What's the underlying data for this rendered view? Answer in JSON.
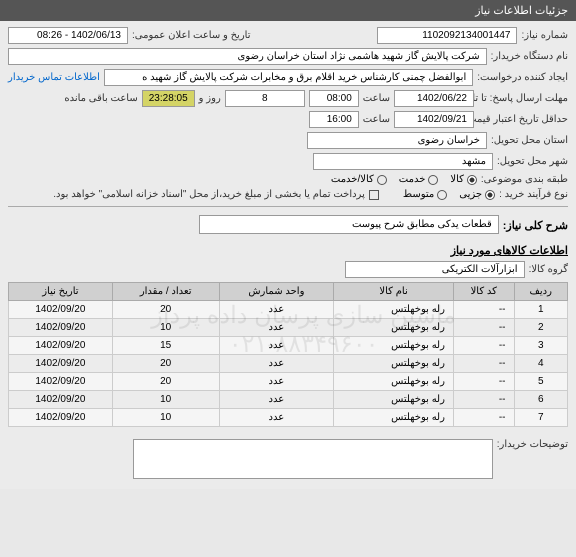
{
  "header": {
    "title": "جزئیات اطلاعات نیاز"
  },
  "fields": {
    "need_number_label": "شماره نیاز:",
    "need_number": "1102092134001447",
    "announce_label": "تاریخ و ساعت اعلان عمومی:",
    "announce_value": "1402/06/13 - 08:26",
    "buyer_label": "نام دستگاه خریدار:",
    "buyer_value": "شرکت پالایش گاز شهید هاشمی نژاد   استان خراسان رضوی",
    "creator_label": "ایجاد کننده درخواست:",
    "creator_value": "ابوالفضل چمنی کارشناس خرید اقلام برق و مخابرات شرکت پالایش گاز شهید ه",
    "contact_link": "اطلاعات تماس خریدار",
    "deadline_label": "مهلت ارسال پاسخ: تا تاریخ:",
    "deadline_date": "1402/06/22",
    "time_label": "ساعت",
    "deadline_time": "08:00",
    "days_count": "8",
    "days_label": "روز و",
    "remaining_time": "23:28:05",
    "remaining_label": "ساعت باقی مانده",
    "validity_label": "حداقل تاریخ اعتبار قیمت: تا تاریخ:",
    "validity_date": "1402/09/21",
    "validity_time": "16:00",
    "province_label": "استان محل تحویل:",
    "province_value": "خراسان رضوی",
    "city_label": "شهر محل تحویل:",
    "city_value": "مشهد",
    "category_label": "طبقه بندی موضوعی:",
    "cat_goods": "کالا",
    "cat_service": "خدمت",
    "cat_both": "کالا/خدمت",
    "process_label": "نوع فرآیند خرید :",
    "proc_partial": "جزیی",
    "proc_medium": "متوسط",
    "payment_note": "پرداخت تمام یا بخشی از مبلغ خرید،از محل \"اسناد خزانه اسلامی\" خواهد بود.",
    "desc_label": "شرح کلی نیاز:",
    "desc_value": "قطعات یدکی مطابق شرح پیوست",
    "items_header": "اطلاعات کالاهای مورد نیاز",
    "group_label": "گروه کالا:",
    "group_value": "ابزارآلات الکتریکی",
    "buyer_notes_label": "توضیحات خریدار:"
  },
  "table": {
    "headers": {
      "row": "ردیف",
      "code": "کد کالا",
      "name": "نام کالا",
      "unit": "واحد شمارش",
      "qty": "تعداد / مقدار",
      "date": "تاریخ نیاز"
    },
    "rows": [
      {
        "n": "1",
        "code": "--",
        "name": "رله بوخهلتس",
        "unit": "عدد",
        "qty": "20",
        "date": "1402/09/20"
      },
      {
        "n": "2",
        "code": "--",
        "name": "رله بوخهلتس",
        "unit": "عدد",
        "qty": "10",
        "date": "1402/09/20"
      },
      {
        "n": "3",
        "code": "--",
        "name": "رله بوخهلتس",
        "unit": "عدد",
        "qty": "15",
        "date": "1402/09/20"
      },
      {
        "n": "4",
        "code": "--",
        "name": "رله بوخهلتس",
        "unit": "عدد",
        "qty": "20",
        "date": "1402/09/20"
      },
      {
        "n": "5",
        "code": "--",
        "name": "رله بوخهلتس",
        "unit": "عدد",
        "qty": "20",
        "date": "1402/09/20"
      },
      {
        "n": "6",
        "code": "--",
        "name": "رله بوخهلتس",
        "unit": "عدد",
        "qty": "10",
        "date": "1402/09/20"
      },
      {
        "n": "7",
        "code": "--",
        "name": "رله بوخهلتس",
        "unit": "عدد",
        "qty": "10",
        "date": "1402/09/20"
      }
    ]
  },
  "watermark": {
    "line1": "ماشین سازی پرسان داده پرداز",
    "line2": "۰۲۱-۸۸۳۴۹۶۰۰"
  }
}
